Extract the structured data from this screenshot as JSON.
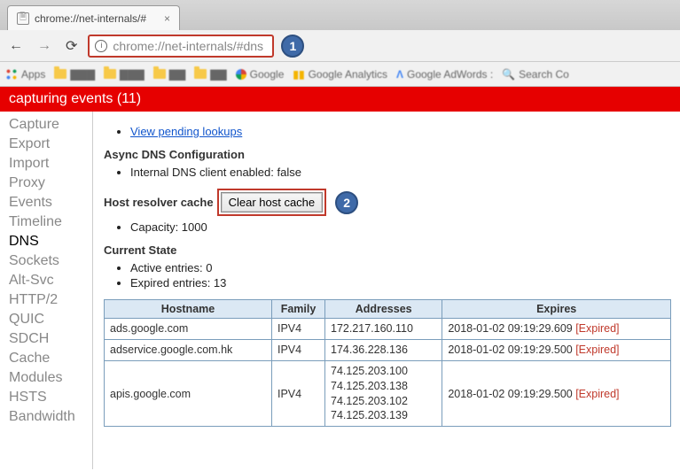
{
  "tab": {
    "title": "chrome://net-internals/#",
    "close": "×"
  },
  "toolbar": {
    "back": "←",
    "forward": "→",
    "reload": "⟳",
    "info": "i",
    "address": "chrome://net-internals/#dns"
  },
  "callouts": {
    "one": "1",
    "two": "2"
  },
  "bookmarks": {
    "apps": "Apps",
    "items": [
      {
        "label": "▇▇▇"
      },
      {
        "label": "▇▇▇"
      },
      {
        "label": "▇▇"
      },
      {
        "label": "▇▇"
      }
    ],
    "google": "Google",
    "analytics": "Google Analytics",
    "adwords": "Google AdWords : ",
    "search": "Search Co"
  },
  "banner": "capturing events (11)",
  "sidebar": {
    "items": [
      "Capture",
      "Export",
      "Import",
      "Proxy",
      "Events",
      "Timeline",
      "DNS",
      "Sockets",
      "Alt-Svc",
      "HTTP/2",
      "QUIC",
      "SDCH",
      "Cache",
      "Modules",
      "HSTS",
      "Bandwidth"
    ],
    "selected": "DNS"
  },
  "content": {
    "view_pending": "View pending lookups",
    "async_title": "Async DNS Configuration",
    "internal_dns": "Internal DNS client enabled: false",
    "host_cache_label": "Host resolver cache",
    "clear_btn": "Clear host cache",
    "capacity": "Capacity: 1000",
    "current_state": "Current State",
    "active": "Active entries: 0",
    "expired": "Expired entries: 13",
    "headers": {
      "host": "Hostname",
      "family": "Family",
      "addr": "Addresses",
      "exp": "Expires"
    },
    "expired_tag": "[Expired]",
    "rows": [
      {
        "host": "ads.google.com",
        "family": "IPV4",
        "addr": "172.217.160.110",
        "exp": "2018-01-02 09:19:29.609"
      },
      {
        "host": "adservice.google.com.hk",
        "family": "IPV4",
        "addr": "174.36.228.136",
        "exp": "2018-01-02 09:19:29.500"
      },
      {
        "host": "apis.google.com",
        "family": "IPV4",
        "addr": "74.125.203.100\n74.125.203.138\n74.125.203.102\n74.125.203.139",
        "exp": "2018-01-02 09:19:29.500"
      }
    ]
  }
}
